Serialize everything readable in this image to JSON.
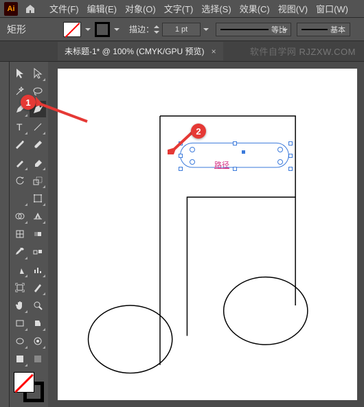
{
  "app": {
    "logo": "Ai"
  },
  "menu": [
    "文件(F)",
    "编辑(E)",
    "对象(O)",
    "文字(T)",
    "选择(S)",
    "效果(C)",
    "视图(V)",
    "窗口(W)"
  ],
  "control": {
    "shape_label": "矩形",
    "stroke_label": "描边：",
    "stroke_pt": "1 pt",
    "scale_label": "等比",
    "basic_label": "基本"
  },
  "tab": {
    "title": "未标题-1* @ 100% (CMYK/GPU 预览)",
    "close": "×"
  },
  "watermark": {
    "a": "软件自学网",
    "b": "RJZXW.COM"
  },
  "tools": [
    "selection",
    "direct-selection",
    "magic-wand",
    "lasso",
    "pen",
    "curvature",
    "type",
    "line",
    "paintbrush",
    "blob-brush",
    "shaper",
    "eraser",
    "rotate",
    "scale",
    "width",
    "free-transform",
    "shape-builder",
    "perspective",
    "mesh",
    "gradient",
    "eyedropper",
    "blend",
    "symbol-sprayer",
    "column-graph",
    "artboard",
    "slice",
    "hand",
    "zoom",
    "live-paint",
    "live-paint-select",
    "rectangle",
    "ellipse",
    "print-tiling",
    "color"
  ],
  "callouts": {
    "one": "1",
    "two": "2"
  },
  "canvas": {
    "path_label": "路径"
  }
}
